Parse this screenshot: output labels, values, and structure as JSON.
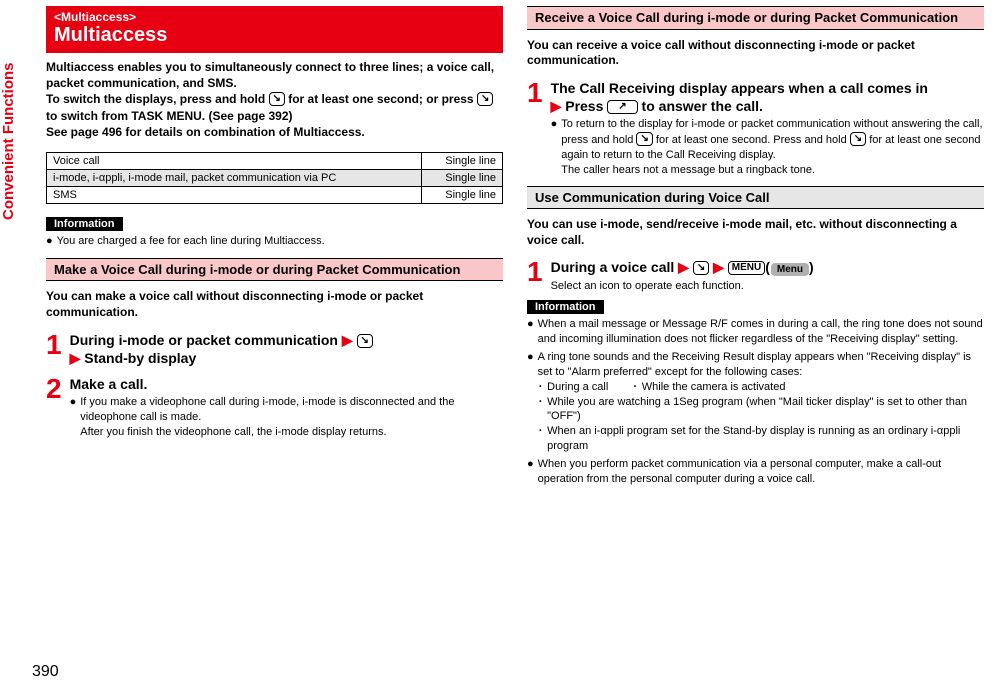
{
  "page_number": "390",
  "section_label": "Convenient Functions",
  "left": {
    "header_tag": "<Multiaccess>",
    "header_title": "Multiaccess",
    "lead_1": "Multiaccess enables you to simultaneously connect to three lines; a voice call, packet communication, and SMS.",
    "lead_2a": "To switch the displays, press and hold ",
    "lead_2_key": "↘",
    "lead_2b": " for at least one second; or press ",
    "lead_2c": " to switch from TASK MENU. (See page 392)",
    "lead_3": "See page 496 for details on combination of Multiaccess.",
    "table": {
      "rows": [
        {
          "label": "Voice call",
          "value": "Single line"
        },
        {
          "label": "i-mode, i-αppli, i-mode mail, packet communication via PC",
          "value": "Single line"
        },
        {
          "label": "SMS",
          "value": "Single line"
        }
      ]
    },
    "info_label": "Information",
    "info_items": [
      "You are charged a fee for each line during Multiaccess."
    ],
    "sub1_title": "Make a Voice Call during i-mode or during Packet Communication",
    "sub1_intro": "You can make a voice call without disconnecting i-mode or packet communication.",
    "step1": {
      "num": "1",
      "main_a": "During i-mode or packet communication",
      "main_b": "Stand-by display"
    },
    "step2": {
      "num": "2",
      "main": "Make a call.",
      "sub_a": "If you make a videophone call during i-mode, i-mode is disconnected and the videophone call is made.",
      "sub_b": "After you finish the videophone call, the i-mode display returns."
    }
  },
  "right": {
    "sub2_title": "Receive a Voice Call during i-mode or during Packet Communication",
    "sub2_intro": "You can receive a voice call without disconnecting i-mode or packet communication.",
    "r_step1": {
      "num": "1",
      "main_a": "The Call Receiving display appears when a call comes in",
      "main_b": "Press ",
      "main_c": " to answer the call.",
      "key_call": "↗",
      "sub_a_1": "To return to the display for i-mode or packet communication without answering the call, press and hold ",
      "sub_a_2": " for at least one second. Press and hold ",
      "sub_a_3": " for at least one second again to return to the Call Receiving display.",
      "sub_b": "The caller hears not a message but a ringback tone."
    },
    "sub3_title": "Use Communication during Voice Call",
    "sub3_intro": "You can use i-mode, send/receive i-mode mail, etc. without disconnecting a voice call.",
    "r_step2": {
      "num": "1",
      "main_a": "During a voice call",
      "menu_key": "MENU",
      "menu_soft": "Menu",
      "sub": "Select an icon to operate each function."
    },
    "info_label": "Information",
    "info_items": [
      "When a mail message or Message R/F comes in during a call, the ring tone does not sound and incoming illumination does not flicker regardless of the \"Receiving display\" setting.",
      "A ring tone sounds and the Receiving Result display appears when \"Receiving display\" is set to \"Alarm preferred\" except for the following cases:",
      "When you perform packet communication via a personal computer, make a call-out operation from the personal computer during a voice call."
    ],
    "info_subcases": [
      "During a call",
      "While the camera is activated",
      "While you are watching a 1Seg program (when \"Mail ticker display\" is set to other than \"OFF\")",
      "When an i-αppli program set for the Stand-by display is running as an ordinary i-αppli program"
    ]
  }
}
